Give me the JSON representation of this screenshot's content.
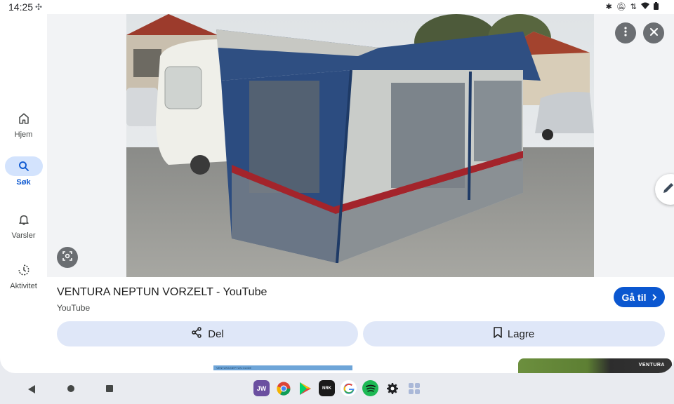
{
  "status_bar": {
    "time": "14:25",
    "time_extra_icon": "pinwheel-icon",
    "icons": [
      "bluetooth-icon",
      "notifications-off-icon",
      "data-arrows-icon",
      "wifi-icon",
      "battery-icon"
    ]
  },
  "nav_rail": {
    "items": [
      {
        "label": "Hjem",
        "icon": "home-icon",
        "active": false
      },
      {
        "label": "Søk",
        "icon": "search-icon",
        "active": true
      },
      {
        "label": "Varsler",
        "icon": "bell-icon",
        "active": false
      },
      {
        "label": "Aktivitet",
        "icon": "activity-icon",
        "active": false
      }
    ]
  },
  "image_viewer": {
    "image_subject": "Caravan with blue awning tent on gravel lot",
    "more_icon": "more-vert-icon",
    "close_icon": "close-icon",
    "lens_icon": "lens-icon",
    "edit_icon": "pencil-icon"
  },
  "result": {
    "title": "VENTURA NEPTUN VORZELT - YouTube",
    "source": "YouTube",
    "goto_label": "Gå til"
  },
  "actions": {
    "share_label": "Del",
    "save_label": "Lagre"
  },
  "related": {
    "thumb1_text": "VENTURA NEPTUN GUIDE",
    "thumb2_text": "VENTURA"
  },
  "dock": {
    "apps": [
      "jw-library-icon",
      "chrome-icon",
      "play-store-icon",
      "nrk-radio-icon",
      "google-icon",
      "spotify-icon",
      "settings-icon",
      "app-drawer-icon"
    ],
    "jw_label": "JW",
    "nrk_label": "NRK"
  },
  "colors": {
    "accent": "#0b57d0",
    "pill_active": "#d3e3fd",
    "action_button": "#dfe7f8"
  }
}
